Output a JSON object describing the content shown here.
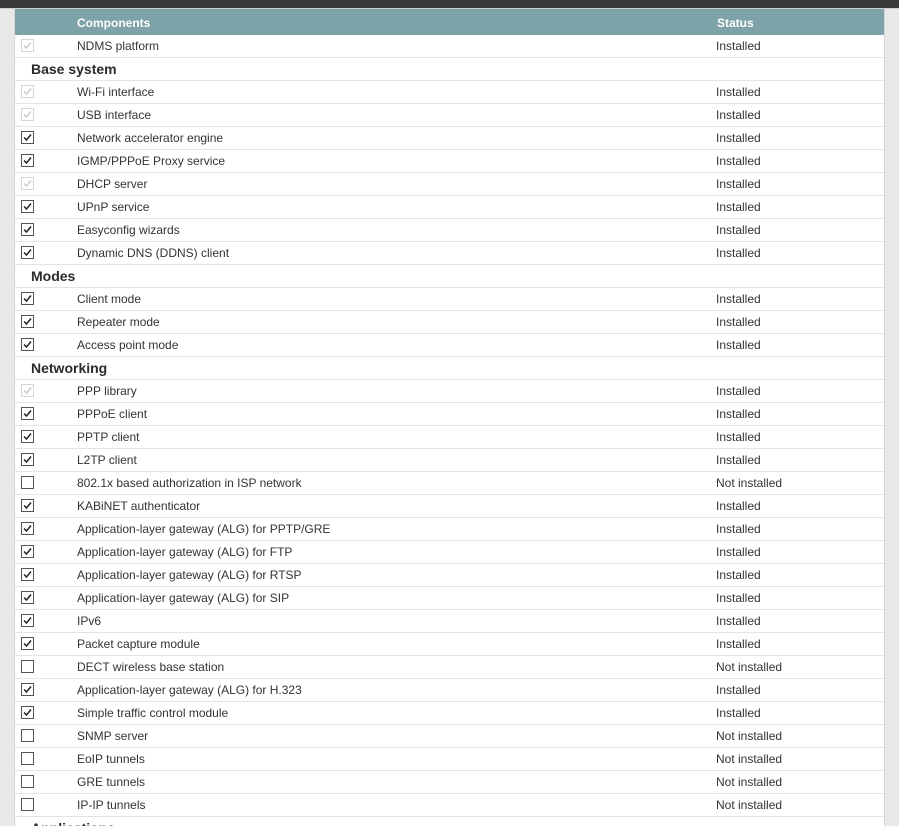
{
  "header": {
    "components_label": "Components",
    "status_label": "Status"
  },
  "platform": {
    "name": "NDMS platform",
    "status": "Installed",
    "checked": true,
    "disabled": true
  },
  "groups": [
    {
      "title": "Base system",
      "items": [
        {
          "name": "Wi-Fi interface",
          "status": "Installed",
          "checked": true,
          "disabled": true
        },
        {
          "name": "USB interface",
          "status": "Installed",
          "checked": true,
          "disabled": true
        },
        {
          "name": "Network accelerator engine",
          "status": "Installed",
          "checked": true,
          "disabled": false
        },
        {
          "name": "IGMP/PPPoE Proxy service",
          "status": "Installed",
          "checked": true,
          "disabled": false
        },
        {
          "name": "DHCP server",
          "status": "Installed",
          "checked": true,
          "disabled": true
        },
        {
          "name": "UPnP service",
          "status": "Installed",
          "checked": true,
          "disabled": false
        },
        {
          "name": "Easyconfig wizards",
          "status": "Installed",
          "checked": true,
          "disabled": false
        },
        {
          "name": "Dynamic DNS (DDNS) client",
          "status": "Installed",
          "checked": true,
          "disabled": false
        }
      ]
    },
    {
      "title": "Modes",
      "items": [
        {
          "name": "Client mode",
          "status": "Installed",
          "checked": true,
          "disabled": false
        },
        {
          "name": "Repeater mode",
          "status": "Installed",
          "checked": true,
          "disabled": false
        },
        {
          "name": "Access point mode",
          "status": "Installed",
          "checked": true,
          "disabled": false
        }
      ]
    },
    {
      "title": "Networking",
      "items": [
        {
          "name": "PPP library",
          "status": "Installed",
          "checked": true,
          "disabled": true
        },
        {
          "name": "PPPoE client",
          "status": "Installed",
          "checked": true,
          "disabled": false
        },
        {
          "name": "PPTP client",
          "status": "Installed",
          "checked": true,
          "disabled": false
        },
        {
          "name": "L2TP client",
          "status": "Installed",
          "checked": true,
          "disabled": false
        },
        {
          "name": "802.1x based authorization in ISP network",
          "status": "Not installed",
          "checked": false,
          "disabled": false
        },
        {
          "name": "KABiNET authenticator",
          "status": "Installed",
          "checked": true,
          "disabled": false
        },
        {
          "name": "Application-layer gateway (ALG) for PPTP/GRE",
          "status": "Installed",
          "checked": true,
          "disabled": false
        },
        {
          "name": "Application-layer gateway (ALG) for FTP",
          "status": "Installed",
          "checked": true,
          "disabled": false
        },
        {
          "name": "Application-layer gateway (ALG) for RTSP",
          "status": "Installed",
          "checked": true,
          "disabled": false
        },
        {
          "name": "Application-layer gateway (ALG) for SIP",
          "status": "Installed",
          "checked": true,
          "disabled": false
        },
        {
          "name": "IPv6",
          "status": "Installed",
          "checked": true,
          "disabled": false
        },
        {
          "name": "Packet capture module",
          "status": "Installed",
          "checked": true,
          "disabled": false
        },
        {
          "name": "DECT wireless base station",
          "status": "Not installed",
          "checked": false,
          "disabled": false
        },
        {
          "name": "Application-layer gateway (ALG) for H.323",
          "status": "Installed",
          "checked": true,
          "disabled": false
        },
        {
          "name": "Simple traffic control module",
          "status": "Installed",
          "checked": true,
          "disabled": false
        },
        {
          "name": "SNMP server",
          "status": "Not installed",
          "checked": false,
          "disabled": false
        },
        {
          "name": "EoIP tunnels",
          "status": "Not installed",
          "checked": false,
          "disabled": false
        },
        {
          "name": "GRE tunnels",
          "status": "Not installed",
          "checked": false,
          "disabled": false
        },
        {
          "name": "IP-IP tunnels",
          "status": "Not installed",
          "checked": false,
          "disabled": false
        }
      ]
    },
    {
      "title": "Applications",
      "items": []
    }
  ],
  "icons": {
    "check": "checkmark-icon"
  },
  "colors": {
    "header_bg": "#7da2a8",
    "header_text": "#ffffff",
    "check_enabled": "#222222",
    "check_disabled": "#cccccc"
  }
}
